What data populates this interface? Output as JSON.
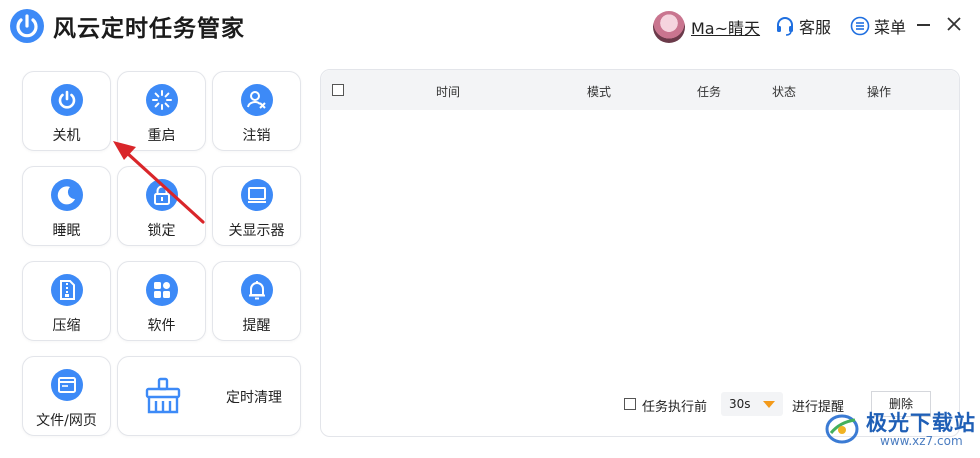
{
  "app": {
    "title": "风云定时任务管家"
  },
  "header": {
    "username": "Ma~睛天",
    "support_label": "客服",
    "menu_label": "菜单"
  },
  "tiles": [
    {
      "label": "关机",
      "icon": "power-icon"
    },
    {
      "label": "重启",
      "icon": "restart-icon"
    },
    {
      "label": "注销",
      "icon": "logout-user-icon"
    },
    {
      "label": "睡眠",
      "icon": "moon-icon"
    },
    {
      "label": "锁定",
      "icon": "lock-icon"
    },
    {
      "label": "关显示器",
      "icon": "monitor-icon"
    },
    {
      "label": "压缩",
      "icon": "archive-icon"
    },
    {
      "label": "软件",
      "icon": "apps-icon"
    },
    {
      "label": "提醒",
      "icon": "bell-icon"
    },
    {
      "label": "文件/网页",
      "icon": "browser-window-icon"
    },
    {
      "label": "定时清理",
      "icon": "broom-icon"
    }
  ],
  "table": {
    "columns": [
      "时间",
      "模式",
      "任务",
      "状态",
      "操作"
    ],
    "rows": []
  },
  "footer": {
    "remind_checkbox_label": "任务执行前",
    "interval_value": "30s",
    "remind_suffix": "进行提醒",
    "delete_label": "删除"
  },
  "watermark": {
    "name": "极光下载站",
    "url": "www.xz7.com"
  },
  "colors": {
    "accent": "#3d8af7",
    "annotation_arrow": "#d9262a",
    "dropdown_arrow": "#f39a1a"
  }
}
